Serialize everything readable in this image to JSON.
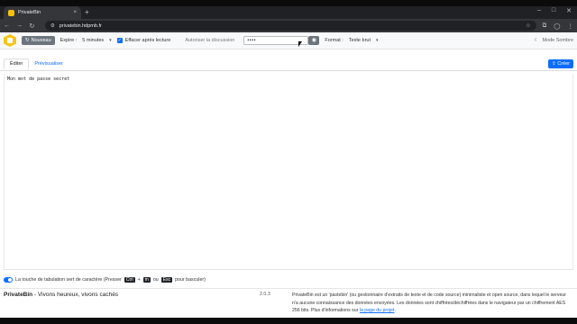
{
  "browser": {
    "tab_title": "PrivateBin",
    "tab_close": "×",
    "new_tab": "+",
    "url": "privatebin.hdpmb.fr",
    "window_controls": [
      "–",
      "□",
      "✕"
    ],
    "nav": {
      "back": "←",
      "forward": "→",
      "reload": "↻",
      "menu": "⋮"
    }
  },
  "toolbar": {
    "new_label": "Nouveau",
    "expire_label": "Expire :",
    "expire_value": "5 minutes",
    "burn_label": "Effacer après lecture",
    "discussion_label": "Autoriser la discussion",
    "password_value": "••••",
    "format_label": "Format :",
    "format_value": "Texte brut",
    "dark_mode_label": "Mode Sombre"
  },
  "tabs": {
    "edit": "Éditer",
    "preview": "Prévisualiser",
    "create": "Créer"
  },
  "editor": {
    "content": "Mon mot de passe secret"
  },
  "tabkey": {
    "text_before": "La touche de tabulation sert de caractère (Presser",
    "key1": "Ctrl",
    "plus": "+",
    "key2": "m",
    "or": "ou",
    "key3": "Esc",
    "text_after": "pour basculer)"
  },
  "footer": {
    "brand_name": "PrivateBin",
    "brand_tagline": " - Vivons heureux, vivons cachés",
    "version": "2.0.3",
    "about_text": "PrivateBin est un 'pastebin' (ou gestionnaire d'extraits de texte et de code source) minimaliste et open source, dans lequel le serveur n'a aucune connaissance des données envoyées. Les données sont chiffrées/déchiffrées dans le navigateur par un chiffrement AES 256 bits. Plus d'informations sur ",
    "about_link": "la page du projet",
    "about_end": "."
  },
  "colors": {
    "primary": "#0d6efd",
    "secondary": "#6c757d",
    "logo": "#f5c518"
  }
}
